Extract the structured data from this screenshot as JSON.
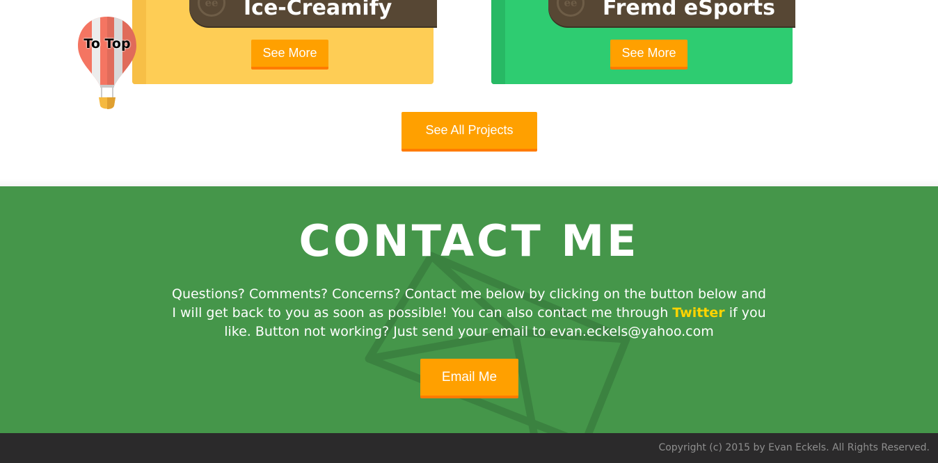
{
  "projects": [
    {
      "title": "Ice-Creamify",
      "button_label": "See More",
      "color": "#fecd55",
      "logo": "ee"
    },
    {
      "title": "Fremd eSports",
      "button_label": "See More",
      "color": "#2ecc71",
      "logo": "ee"
    }
  ],
  "all_projects_button": "See All Projects",
  "to_top": {
    "label": "To Top",
    "icon": "hot-air-balloon-icon"
  },
  "contact": {
    "title": "CONTACT ME",
    "text_before_link": "Questions? Comments? Concerns? Contact me below by clicking on the button below and I will get back to you as soon as possible! You can also contact me through ",
    "link_label": "Twitter",
    "text_after_link": " if you like. Button not working? Just send your email to evan.eckels@yahoo.com",
    "email_button": "Email Me",
    "background_color": "#45964a",
    "background_icon": "envelope-icon"
  },
  "footer": {
    "copyright": "Copyright (c) 2015 by Evan Eckels. All Rights Reserved."
  },
  "accent_color": "#ffa000"
}
